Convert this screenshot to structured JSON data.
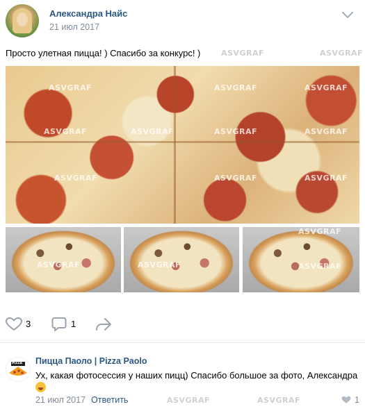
{
  "post": {
    "author": "Александра Найс",
    "date": "21 июл 2017",
    "text": "Просто улетная пицца! ) Спасибо за конкурс! )",
    "watermark": "ASVGRAF"
  },
  "actions": {
    "likes": "3",
    "comments": "1"
  },
  "comment": {
    "author": "Пицца Паоло | Pizza Paolo",
    "avatar_text": "PIZZA",
    "text": "Ух, какая фотосессия у наших пицц) Спасибо большое за фото, Александра",
    "date": "21 июл 2017",
    "reply_label": "Ответить",
    "likes": "1"
  },
  "icons": {
    "more": "chevron-down-icon",
    "like": "heart-icon",
    "comment": "comment-icon",
    "share": "share-icon",
    "emoji": "smile-emoji-icon"
  },
  "colors": {
    "link": "#2a5885",
    "muted": "#818c99",
    "divider": "#e7e8ec"
  }
}
